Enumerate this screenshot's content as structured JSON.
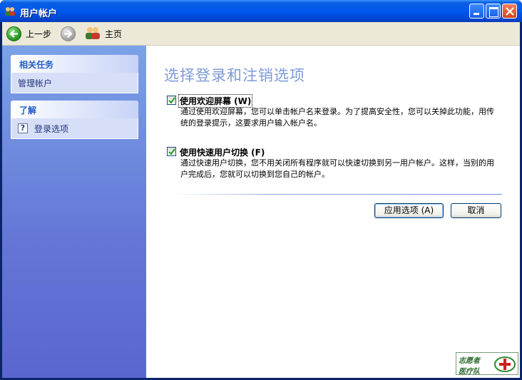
{
  "window": {
    "title": "用户帐户"
  },
  "toolbar": {
    "back_label": "上一步",
    "home_label": "主页"
  },
  "sidebar": {
    "related_tasks": {
      "header": "相关任务",
      "items": [
        {
          "label": "管理帐户"
        }
      ]
    },
    "learn_about": {
      "header": "了解",
      "items": [
        {
          "label": "登录选项",
          "icon": "help-icon"
        }
      ]
    }
  },
  "main": {
    "heading": "选择登录和注销选项",
    "options": [
      {
        "title": "使用欢迎屏幕 (W)",
        "checked": true,
        "description": "通过使用欢迎屏幕，您可以单击帐户名来登录。为了提高安全性，您可以关掉此功能，用传统的登录提示，这要求用户输入帐户名。"
      },
      {
        "title": "使用快速用户切换 (F)",
        "checked": true,
        "description": "通过快速用户切换，您不用关闭所有程序就可以快速切换到另一用户帐户。这样，当别的用户完成后，您就可以切换到您自己的帐户。"
      }
    ],
    "apply_label": "应用选项 (A)",
    "cancel_label": "取消"
  },
  "watermark": {
    "line1": "志愿者",
    "line2": "医疗队"
  },
  "colors": {
    "titlebar": "#0058ee",
    "sidebar": "#6375d6",
    "heading": "#7d9ad7",
    "sidebar_header_text": "#215dc6"
  }
}
